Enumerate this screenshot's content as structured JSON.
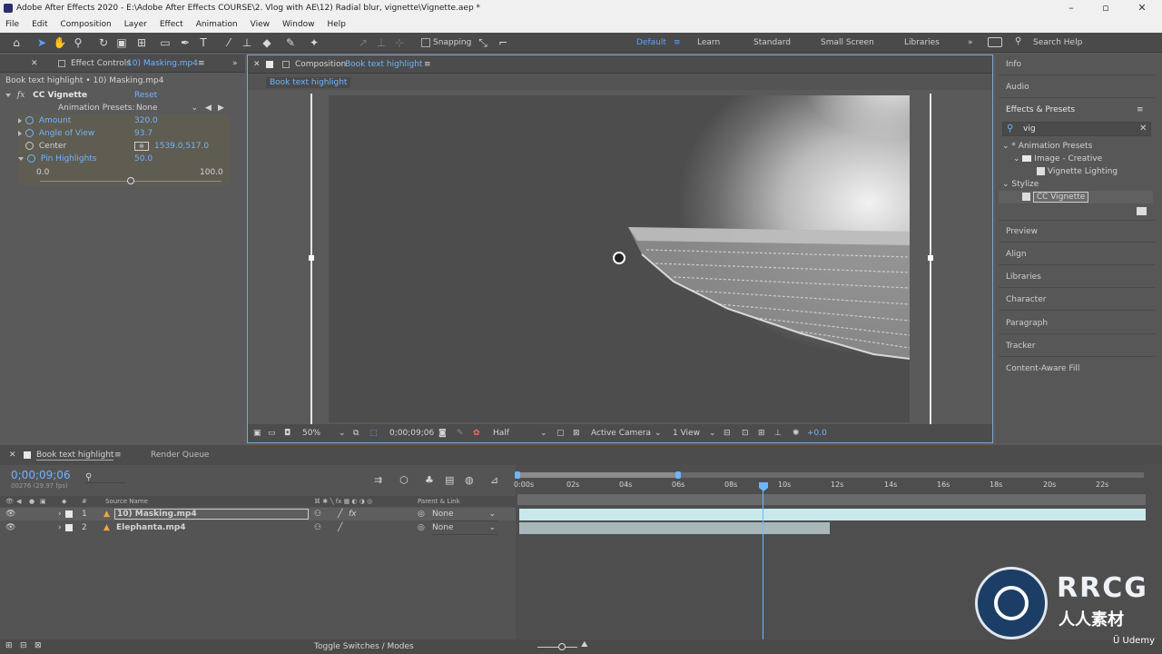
{
  "window": {
    "title": "Adobe After Effects 2020 - E:\\Adobe After Effects COURSE\\2. Vlog with AE\\12) Radial blur, vignette\\Vignette.aep *"
  },
  "menu": [
    "File",
    "Edit",
    "Composition",
    "Layer",
    "Effect",
    "Animation",
    "View",
    "Window",
    "Help"
  ],
  "toolbar": {
    "snapping_label": "Snapping",
    "workspaces": [
      "Default",
      "Learn",
      "Standard",
      "Small Screen",
      "Libraries"
    ],
    "active_workspace": "Default",
    "search_help": "Search Help"
  },
  "effect_controls": {
    "tab_label": "Effect Controls",
    "tab_file": "10) Masking.mp4",
    "breadcrumb": "Book text highlight • 10) Masking.mp4",
    "effect_name": "CC Vignette",
    "reset_label": "Reset",
    "presets_label": "Animation Presets:",
    "presets_value": "None",
    "params": [
      {
        "label": "Amount",
        "value": "320.0"
      },
      {
        "label": "Angle of View",
        "value": "93.7"
      },
      {
        "label": "Center",
        "value": "1539.0,517.0"
      },
      {
        "label": "Pin Highlights",
        "value": "50.0"
      }
    ],
    "slider_min": "0.0",
    "slider_max": "100.0",
    "slider_fraction": 0.5
  },
  "composition": {
    "tab_prefix": "Composition",
    "tab_name": "Book text highlight",
    "subtab": "Book text highlight",
    "zoom": "50%",
    "timecode": "0;00;09;06",
    "resolution": "Half",
    "camera": "Active Camera",
    "views": "1 View",
    "exposure": "+0.0"
  },
  "right_panel": {
    "items_top": [
      "Info",
      "Audio",
      "Effects & Presets"
    ],
    "search_value": "vig",
    "tree": [
      {
        "label": "* Animation Presets",
        "level": 0
      },
      {
        "label": "Image - Creative",
        "level": 1
      },
      {
        "label": "Vignette Lighting",
        "level": 2
      },
      {
        "label": "Stylize",
        "level": 0
      },
      {
        "label": "CC Vignette",
        "level": 1
      }
    ],
    "items_bottom": [
      "Preview",
      "Align",
      "Libraries",
      "Character",
      "Paragraph",
      "Tracker",
      "Content-Aware Fill"
    ]
  },
  "timeline": {
    "tab_label": "Book text highlight",
    "render_queue": "Render Queue",
    "timecode": "0;00;09;06",
    "frame_info": "00276 (29.97 fps)",
    "col_source": "Source Name",
    "col_parent": "Parent & Link",
    "layers": [
      {
        "num": "1",
        "name": "10) Masking.mp4",
        "parent": "None"
      },
      {
        "num": "2",
        "name": "Elephanta.mp4",
        "parent": "None"
      }
    ],
    "ruler_labels": [
      "0:00s",
      "02s",
      "04s",
      "06s",
      "08s",
      "10s",
      "12s",
      "14s",
      "16s",
      "18s",
      "20s",
      "22s"
    ],
    "toggle_label": "Toggle Switches / Modes"
  },
  "watermark": {
    "brand": "RRCG",
    "subtitle": "人人素材",
    "platform": "Udemy"
  }
}
